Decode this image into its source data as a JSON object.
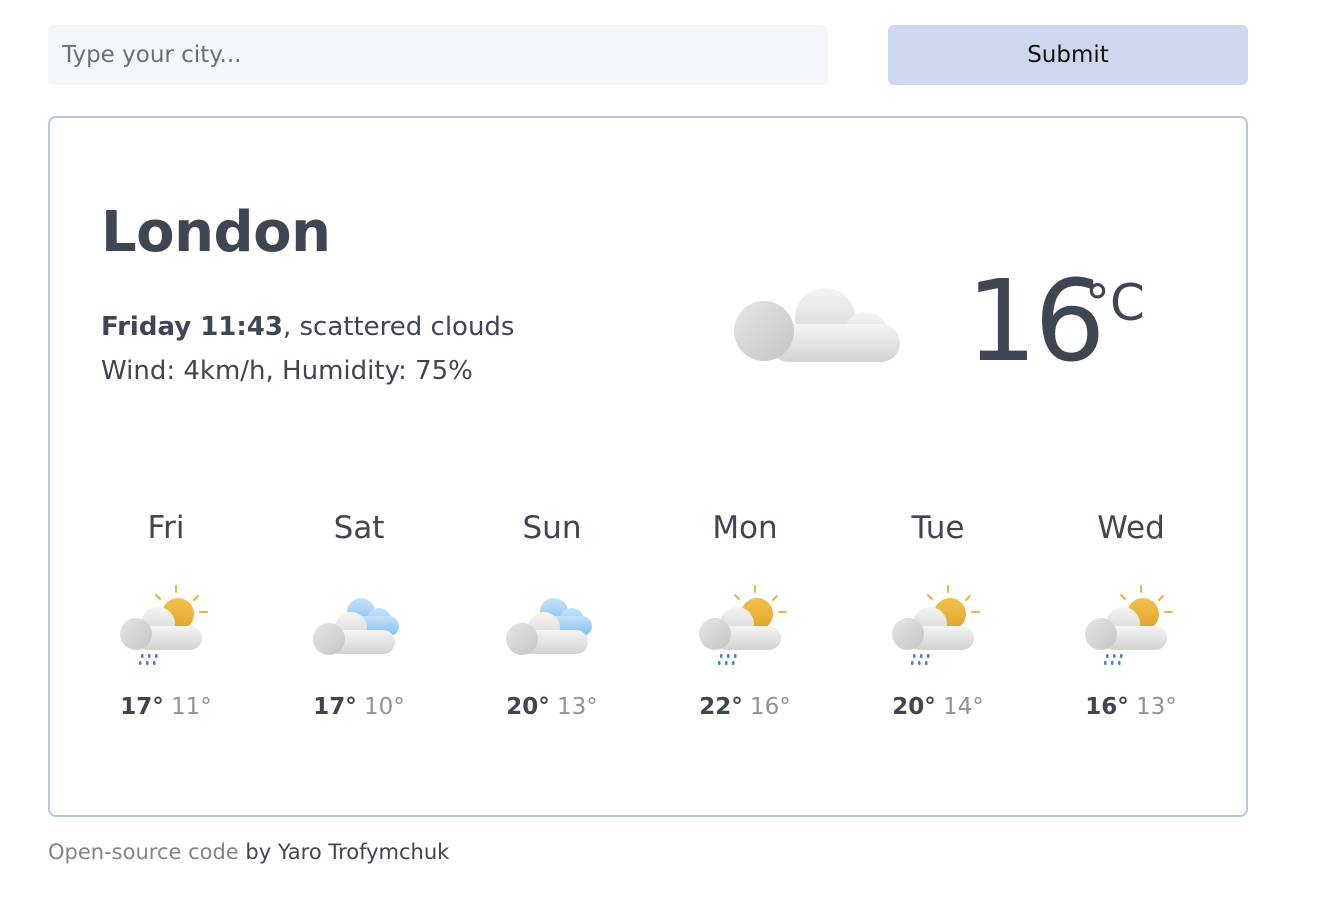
{
  "search": {
    "placeholder": "Type your city...",
    "value": "",
    "submit_label": "Submit"
  },
  "current": {
    "city": "London",
    "day_time": "Friday 11:43",
    "condition": ", scattered clouds",
    "details": "Wind: 4km/h, Humidity: 75%",
    "temperature": "16",
    "unit": "°C",
    "icon": "cloud-icon"
  },
  "forecast": [
    {
      "day": "Fri",
      "max": "17°",
      "min": "11°",
      "icon": "rain-sun-icon"
    },
    {
      "day": "Sat",
      "max": "17°",
      "min": "10°",
      "icon": "clouds-icon"
    },
    {
      "day": "Sun",
      "max": "20°",
      "min": "13°",
      "icon": "clouds-icon"
    },
    {
      "day": "Mon",
      "max": "22°",
      "min": "16°",
      "icon": "rain-sun-icon"
    },
    {
      "day": "Tue",
      "max": "20°",
      "min": "14°",
      "icon": "rain-sun-icon"
    },
    {
      "day": "Wed",
      "max": "16°",
      "min": "13°",
      "icon": "rain-sun-icon"
    }
  ],
  "footer": {
    "link_text": "Open-source code",
    "by_text": " by Yaro Trofymchuk"
  },
  "colors": {
    "text": "#3f4552",
    "input_bg": "#f3f6fa",
    "button_bg": "#cbd8ed",
    "card_border": "#b8c6d9",
    "muted": "#8d939c"
  }
}
